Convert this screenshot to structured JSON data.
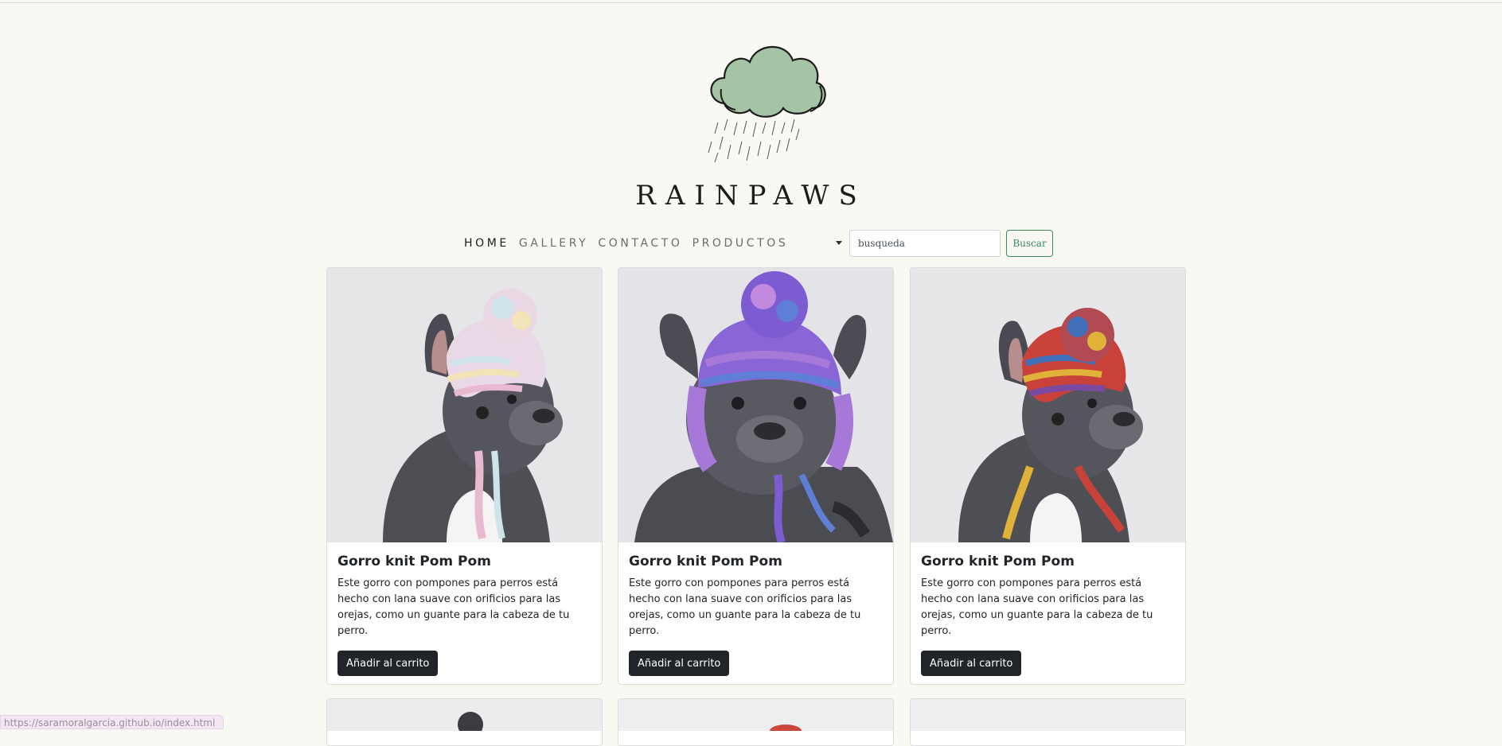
{
  "brand": {
    "name": "RAINPAWS"
  },
  "nav": {
    "items": [
      {
        "label": "HOME",
        "active": true
      },
      {
        "label": "GALLERY",
        "active": false
      },
      {
        "label": "CONTACTO",
        "active": false
      },
      {
        "label": "PRODUCTOS",
        "active": false
      }
    ],
    "search": {
      "value": "busqueda"
    },
    "search_button": "Buscar"
  },
  "products": [
    {
      "title": "Gorro knit Pom Pom",
      "description": "Este gorro con pompones para perros está hecho con lana suave con orificios para las orejas, como un guante para la cabeza de tu perro.",
      "button": "Añadir al carrito",
      "hat_colors": [
        "#e9d8e6",
        "#cfe3ea",
        "#f2e3b8",
        "#e8b9cf"
      ]
    },
    {
      "title": "Gorro knit Pom Pom",
      "description": "Este gorro con pompones para perros está hecho con lana suave con orificios para las orejas, como un guante para la cabeza de tu perro.",
      "button": "Añadir al carrito",
      "hat_colors": [
        "#7d5bd1",
        "#a678d8",
        "#5f7fd6",
        "#c38be0"
      ]
    },
    {
      "title": "Gorro knit Pom Pom",
      "description": "Este gorro con pompones para perros está hecho con lana suave con orificios para las orejas, como un guante para la cabeza de tu perro.",
      "button": "Añadir al carrito",
      "hat_colors": [
        "#c9423a",
        "#3f6fb8",
        "#e0b23a",
        "#7a4aa0"
      ]
    }
  ],
  "status_bar": {
    "url": "https://saramoralgarcia.github.io/index.html"
  },
  "colors": {
    "accent": "#3d8b58",
    "cloud": "#a5c4a6",
    "button_dark": "#212529",
    "background": "#f9f8f3"
  }
}
